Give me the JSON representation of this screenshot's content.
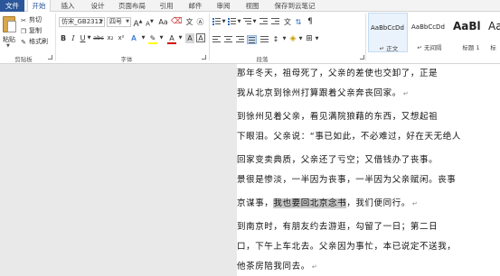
{
  "tabs": [
    "文件",
    "开始",
    "插入",
    "设计",
    "页面布局",
    "引用",
    "邮件",
    "审阅",
    "视图",
    "保存到云笔记"
  ],
  "clipboard": {
    "paste": "粘贴",
    "cut": "剪切",
    "copy": "复制",
    "format_painter": "格式刷",
    "group_label": "剪贴板"
  },
  "font": {
    "name": "仿宋_GB2312",
    "size": "四号",
    "grow": "A",
    "shrink": "A",
    "case": "Aa",
    "bold": "B",
    "italic": "I",
    "underline": "U",
    "strike": "abc",
    "sub": "x₂",
    "sup": "x²",
    "color_a": "A",
    "group_label": "字体",
    "accent_highlight": "#ffff00",
    "accent_font_color": "#d00000"
  },
  "paragraph": {
    "group_label": "段落"
  },
  "styles": {
    "items": [
      {
        "sample": "AaBbCcDd",
        "name": "↵ 正文"
      },
      {
        "sample": "AaBbCcDd",
        "name": "↵ 无间隔"
      },
      {
        "sample": "AaBl",
        "name": "标题 1"
      },
      {
        "sample": "Aa",
        "name": "标"
      }
    ]
  },
  "document": {
    "lines": [
      {
        "pre": "    那年冬天，祖母死了，父亲的差使也交卸了，正是",
        "hl": "",
        "post": "",
        "ret": false
      },
      {
        "pre": "我从北京到徐州打算跟着父亲奔丧回家。",
        "hl": "",
        "post": "",
        "ret": true
      },
      {
        "pre": "    到徐州见着父亲，看见满院狼藉的东西，又想起祖",
        "hl": "",
        "post": "",
        "ret": false
      },
      {
        "pre": "下眼泪。父亲说：“事已如此，不必难过，好在天无绝人",
        "hl": "",
        "post": "",
        "ret": false
      },
      {
        "pre": "    回家变卖典质，父亲还了亏空；又借钱办了丧事。",
        "hl": "",
        "post": "",
        "ret": false
      },
      {
        "pre": "景很是惨淡，一半因为丧事，一半因为父亲赋闲。丧事",
        "hl": "",
        "post": "",
        "ret": false
      },
      {
        "pre": "京谋事，",
        "hl": "我也要回北京念书",
        "post": "，我们便同行。",
        "ret": true
      },
      {
        "pre": "    到南京时，有朋友约去游逛，勾留了一日；第二日",
        "hl": "",
        "post": "",
        "ret": false
      },
      {
        "pre": "口，下午上车北去。父亲因为事忙，本已说定不送我，",
        "hl": "",
        "post": "",
        "ret": false
      },
      {
        "pre": "他茶房陪我同去。",
        "hl": "",
        "post": "",
        "ret": true
      }
    ]
  }
}
